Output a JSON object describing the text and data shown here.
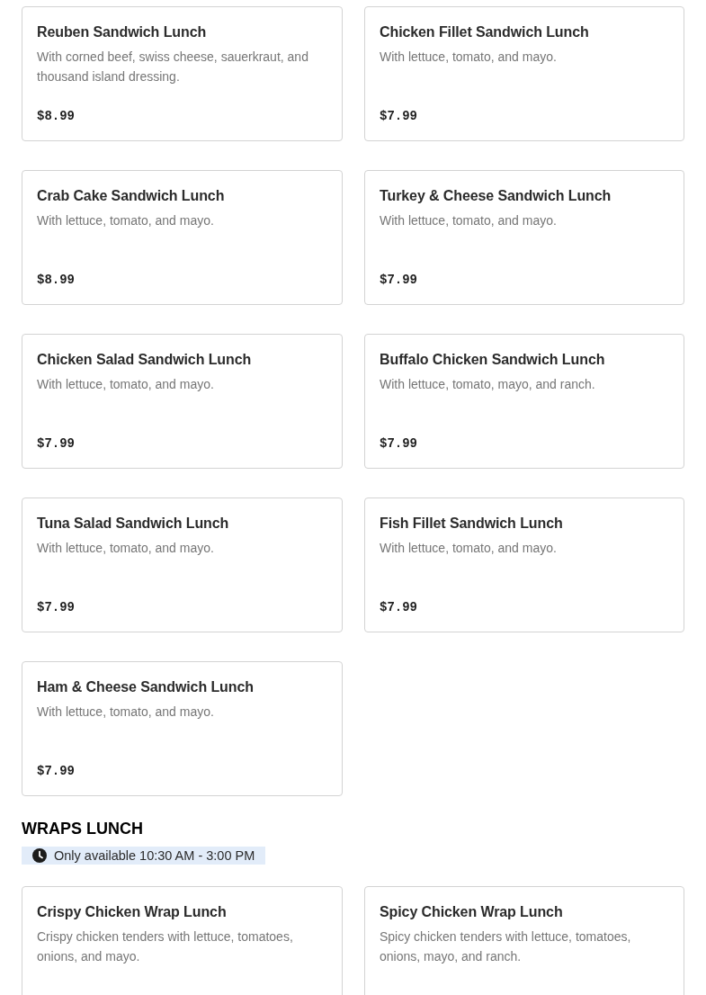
{
  "sections": [
    {
      "items": [
        {
          "name": "Reuben Sandwich Lunch",
          "description": "With corned beef, swiss cheese, sauerkraut, and thousand island dressing.",
          "price": "$8.99"
        },
        {
          "name": "Chicken Fillet Sandwich Lunch",
          "description": "With lettuce, tomato, and mayo.",
          "price": "$7.99"
        },
        {
          "name": "Crab Cake Sandwich Lunch",
          "description": "With lettuce, tomato, and mayo.",
          "price": "$8.99"
        },
        {
          "name": "Turkey & Cheese Sandwich Lunch",
          "description": "With lettuce, tomato, and mayo.",
          "price": "$7.99"
        },
        {
          "name": "Chicken Salad Sandwich Lunch",
          "description": "With lettuce, tomato, and mayo.",
          "price": "$7.99"
        },
        {
          "name": "Buffalo Chicken Sandwich Lunch",
          "description": "With lettuce, tomato, mayo, and ranch.",
          "price": "$7.99"
        },
        {
          "name": "Tuna Salad Sandwich Lunch",
          "description": "With lettuce, tomato, and mayo.",
          "price": "$7.99"
        },
        {
          "name": "Fish Fillet Sandwich Lunch",
          "description": "With lettuce, tomato, and mayo.",
          "price": "$7.99"
        },
        {
          "name": "Ham & Cheese Sandwich Lunch",
          "description": "With lettuce, tomato, and mayo.",
          "price": "$7.99"
        }
      ]
    },
    {
      "title": "WRAPS LUNCH",
      "availability": "Only available 10:30 AM - 3:00 PM",
      "items": [
        {
          "name": "Crispy Chicken Wrap Lunch",
          "description": "Crispy chicken tenders with lettuce, tomatoes, onions, and mayo."
        },
        {
          "name": "Spicy Chicken Wrap Lunch",
          "description": "Spicy chicken tenders with lettuce, tomatoes, onions, mayo, and ranch."
        }
      ]
    }
  ]
}
